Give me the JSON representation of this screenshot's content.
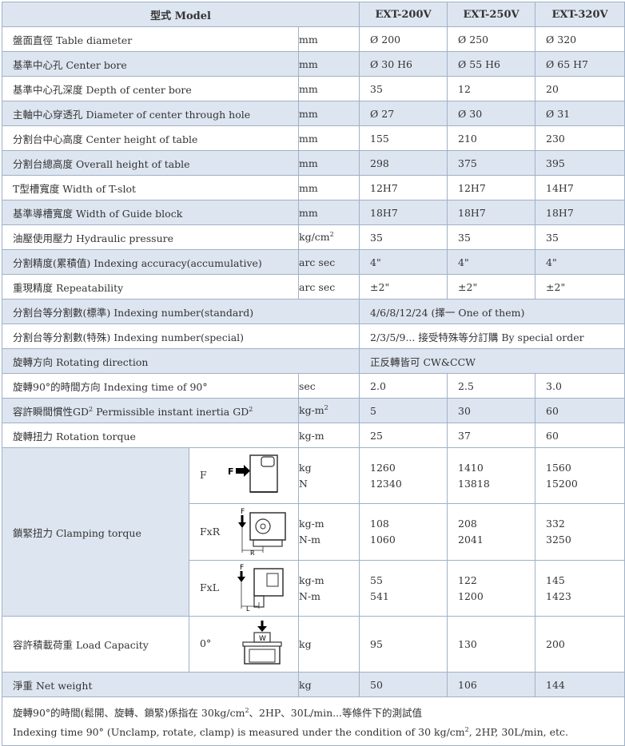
{
  "header": {
    "model": "型式 Model",
    "m1": "EXT-200V",
    "m2": "EXT-250V",
    "m3": "EXT-320V"
  },
  "rows": [
    {
      "label": "盤面直徑 Table diameter",
      "unit": "mm",
      "v1": "Ø 200",
      "v2": "Ø 250",
      "v3": "Ø 320"
    },
    {
      "label": "基準中心孔 Center bore",
      "unit": "mm",
      "v1": "Ø 30 H6",
      "v2": "Ø 55 H6",
      "v3": "Ø 65 H7"
    },
    {
      "label": "基準中心孔深度 Depth of center bore",
      "unit": "mm",
      "v1": "35",
      "v2": "12",
      "v3": "20"
    },
    {
      "label": "主軸中心穿透孔 Diameter of center through hole",
      "unit": "mm",
      "v1": "Ø 27",
      "v2": "Ø 30",
      "v3": "Ø 31"
    },
    {
      "label": "分割台中心高度 Center height of table",
      "unit": "mm",
      "v1": "155",
      "v2": "210",
      "v3": "230"
    },
    {
      "label": "分割台總高度 Overall height of table",
      "unit": "mm",
      "v1": "298",
      "v2": "375",
      "v3": "395"
    },
    {
      "label": "T型槽寬度 Width of T-slot",
      "unit": "mm",
      "v1": "12H7",
      "v2": "12H7",
      "v3": "14H7"
    },
    {
      "label": "基準導槽寬度 Width of Guide block",
      "unit": "mm",
      "v1": "18H7",
      "v2": "18H7",
      "v3": "18H7"
    },
    {
      "label": "油壓使用壓力 Hydraulic pressure",
      "unit": "kg/cm",
      "unit_sup": "2",
      "v1": "35",
      "v2": "35",
      "v3": "35"
    },
    {
      "label": "分割精度(累積值) Indexing accuracy(accumulative)",
      "unit": "arc sec",
      "v1": "4\"",
      "v2": "4\"",
      "v3": "4\""
    },
    {
      "label": "重現精度 Repeatability",
      "unit": "arc sec",
      "v1": "±2\"",
      "v2": "±2\"",
      "v3": "±2\""
    }
  ],
  "merged_rows": [
    {
      "label": "分割台等分割數(標準) Indexing number(standard)",
      "value": "4/6/8/12/24 (擇一 One of them)"
    },
    {
      "label": "分割台等分割數(特殊) Indexing number(special)",
      "value": "2/3/5/9... 接受特殊等分訂購 By special order"
    },
    {
      "label": "旋轉方向 Rotating direction",
      "value": "正反轉皆可 CW&CCW"
    }
  ],
  "rows2": [
    {
      "label": "旋轉90°的時間方向 Indexing time of 90°",
      "unit": "sec",
      "v1": "2.0",
      "v2": "2.5",
      "v3": "3.0"
    },
    {
      "label_a": "容許瞬間慣性GD",
      "label_sup": "2",
      "label_b": " Permissible instant inertia GD",
      "label_sup2": "2",
      "unit": "kg-m",
      "unit_sup": "2",
      "v1": "5",
      "v2": "30",
      "v3": "60"
    },
    {
      "label": "旋轉扭力 Rotation torque",
      "unit": "kg-m",
      "v1": "25",
      "v2": "37",
      "v3": "60"
    }
  ],
  "clamping": {
    "label": "鎖緊扭力 Clamping torque",
    "rows": [
      {
        "type": "F",
        "fig_F": "F",
        "fig_label": "F",
        "unit_a": "kg",
        "unit_b": "N",
        "v1a": "1260",
        "v1b": "12340",
        "v2a": "1410",
        "v2b": "13818",
        "v3a": "1560",
        "v3b": "15200"
      },
      {
        "type": "FxR",
        "fig_F": "F",
        "fig_label": "R",
        "unit_a": "kg-m",
        "unit_b": "N-m",
        "v1a": "108",
        "v1b": "1060",
        "v2a": "208",
        "v2b": "2041",
        "v3a": "332",
        "v3b": "3250"
      },
      {
        "type": "FxL",
        "fig_F": "F",
        "fig_label": "L",
        "unit_a": "kg-m",
        "unit_b": "N-m",
        "v1a": "55",
        "v1b": "541",
        "v2a": "122",
        "v2b": "1200",
        "v3a": "145",
        "v3b": "1423"
      }
    ]
  },
  "load": {
    "label": "容許積載荷重 Load Capacity",
    "type": "0°",
    "fig_label": "W",
    "unit": "kg",
    "v1": "95",
    "v2": "130",
    "v3": "200"
  },
  "net": {
    "label": "淨重 Net weight",
    "unit": "kg",
    "v1": "50",
    "v2": "106",
    "v3": "144"
  },
  "note": {
    "line1_a": "旋轉90°的時間(鬆開、旋轉、鎖緊)係指在 30kg/cm",
    "line1_sup": "2",
    "line1_b": "、2HP、30L/min...等條件下的測試值",
    "line2_a": "Indexing time 90° (Unclamp, rotate, clamp) is measured under the condition of 30 kg/cm",
    "line2_sup": "2",
    "line2_b": ", 2HP, 30L/min, etc."
  },
  "colors": {
    "header_bg": "#dde5f0",
    "border": "#9fb1c8",
    "text": "#333333"
  }
}
